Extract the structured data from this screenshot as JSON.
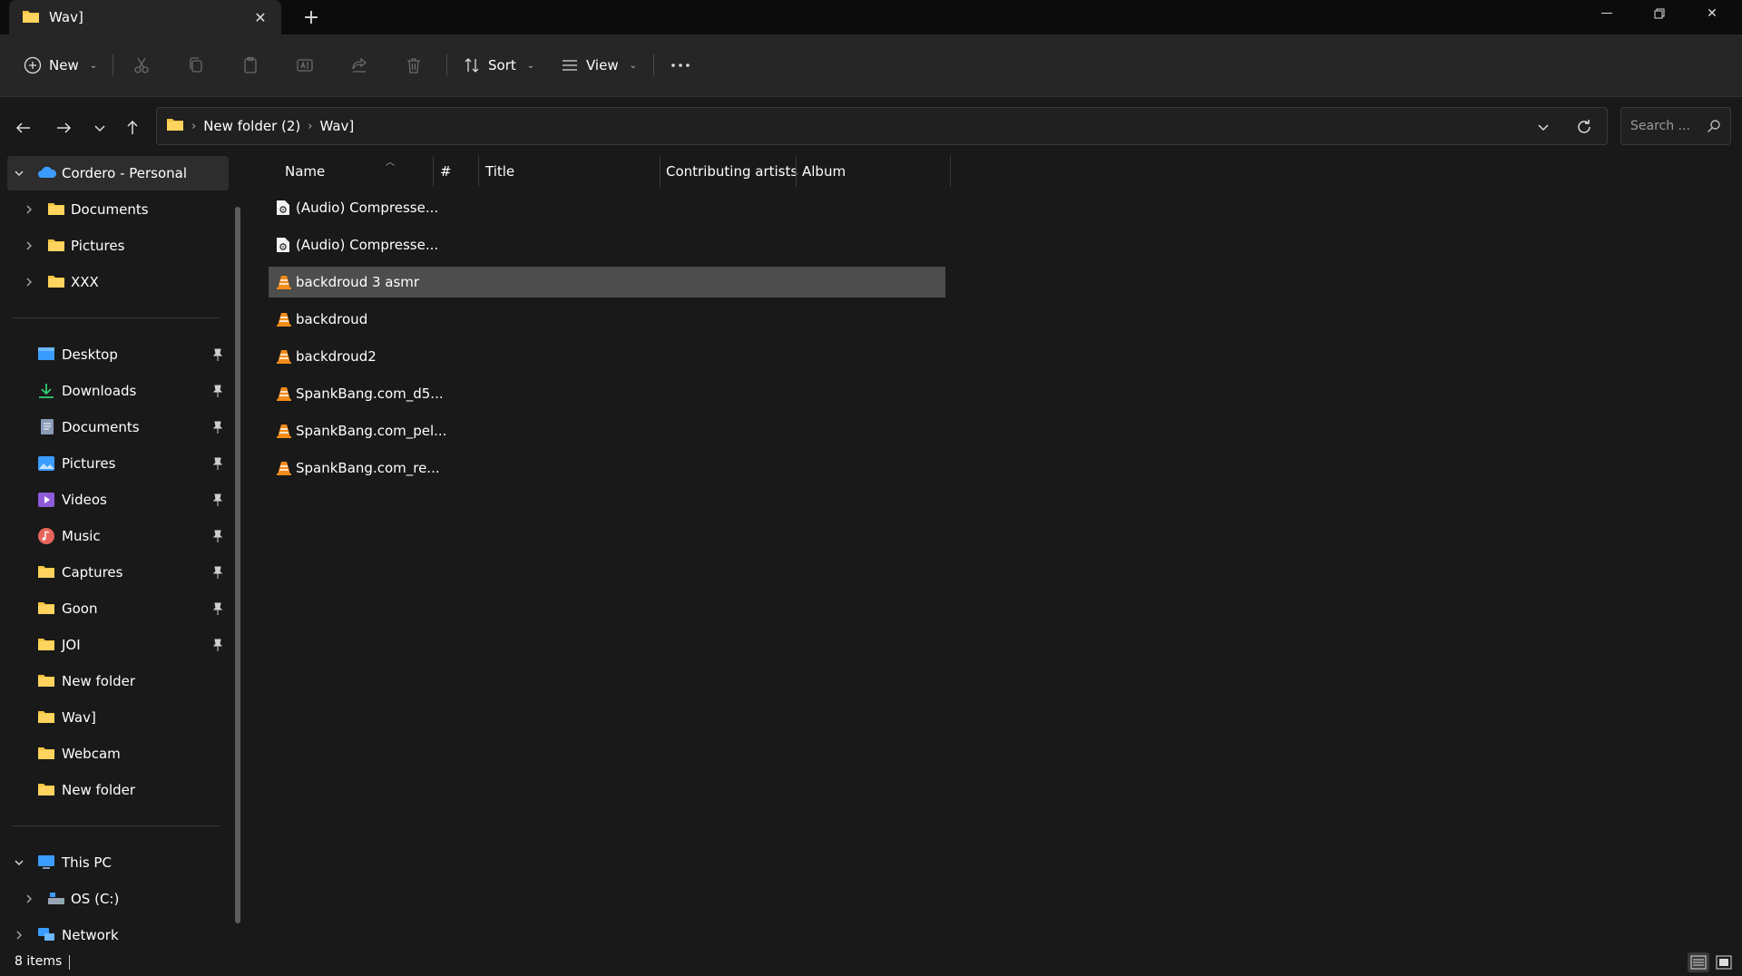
{
  "tab": {
    "title": "Wav]",
    "icon": "folder-icon"
  },
  "window_controls": [
    "minimize-icon",
    "restore-icon",
    "close-icon"
  ],
  "toolbar": {
    "new_label": "New",
    "sort_label": "Sort",
    "view_label": "View",
    "icons": [
      "cut-icon",
      "copy-icon",
      "paste-icon",
      "rename-icon",
      "share-icon",
      "delete-icon",
      "more-icon"
    ]
  },
  "address": {
    "crumbs": [
      "New folder (2)",
      "Wav]"
    ]
  },
  "search": {
    "placeholder": "Search ..."
  },
  "sidebar": {
    "onedrive": {
      "label": "Cordero - Personal"
    },
    "onedrive_children": [
      {
        "label": "Documents"
      },
      {
        "label": "Pictures"
      },
      {
        "label": "XXX"
      }
    ],
    "quick_access": [
      {
        "label": "Desktop",
        "icon": "desktop-icon",
        "pinned": true
      },
      {
        "label": "Downloads",
        "icon": "downloads-icon",
        "pinned": true
      },
      {
        "label": "Documents",
        "icon": "documents-icon",
        "pinned": true
      },
      {
        "label": "Pictures",
        "icon": "pictures-icon",
        "pinned": true
      },
      {
        "label": "Videos",
        "icon": "videos-icon",
        "pinned": true
      },
      {
        "label": "Music",
        "icon": "music-icon",
        "pinned": true
      },
      {
        "label": "Captures",
        "icon": "folder-icon",
        "pinned": true
      },
      {
        "label": "Goon",
        "icon": "folder-icon",
        "pinned": true
      },
      {
        "label": "JOI",
        "icon": "folder-icon",
        "pinned": true
      },
      {
        "label": "New folder",
        "icon": "folder-icon",
        "pinned": false
      },
      {
        "label": "Wav]",
        "icon": "folder-icon",
        "pinned": false
      },
      {
        "label": "Webcam",
        "icon": "folder-icon",
        "pinned": false
      },
      {
        "label": "New folder",
        "icon": "folder-icon",
        "pinned": false
      }
    ],
    "this_pc": {
      "label": "This PC"
    },
    "os_drive": {
      "label": "OS (C:)"
    },
    "network": {
      "label": "Network"
    }
  },
  "columns": [
    "Name",
    "#",
    "Title",
    "Contributing artists",
    "Album"
  ],
  "files": [
    {
      "name": "(Audio) Compresse...",
      "icon": "audio-file-icon",
      "selected": false
    },
    {
      "name": "(Audio) Compresse...",
      "icon": "audio-file-icon",
      "selected": false
    },
    {
      "name": "backdroud 3 asmr",
      "icon": "vlc-file-icon",
      "selected": true
    },
    {
      "name": "backdroud",
      "icon": "vlc-file-icon",
      "selected": false
    },
    {
      "name": "backdroud2",
      "icon": "vlc-file-icon",
      "selected": false
    },
    {
      "name": "SpankBang.com_d5...",
      "icon": "vlc-file-icon",
      "selected": false
    },
    {
      "name": "SpankBang.com_pel...",
      "icon": "vlc-file-icon",
      "selected": false
    },
    {
      "name": "SpankBang.com_re...",
      "icon": "vlc-file-icon",
      "selected": false
    }
  ],
  "status": {
    "item_count": "8 items"
  },
  "colors": {
    "accent_blue": "#3b9cff",
    "folder_yellow": "#f4c542",
    "vlc_orange": "#f28c1a",
    "selection_gray": "#4d4d4d"
  }
}
